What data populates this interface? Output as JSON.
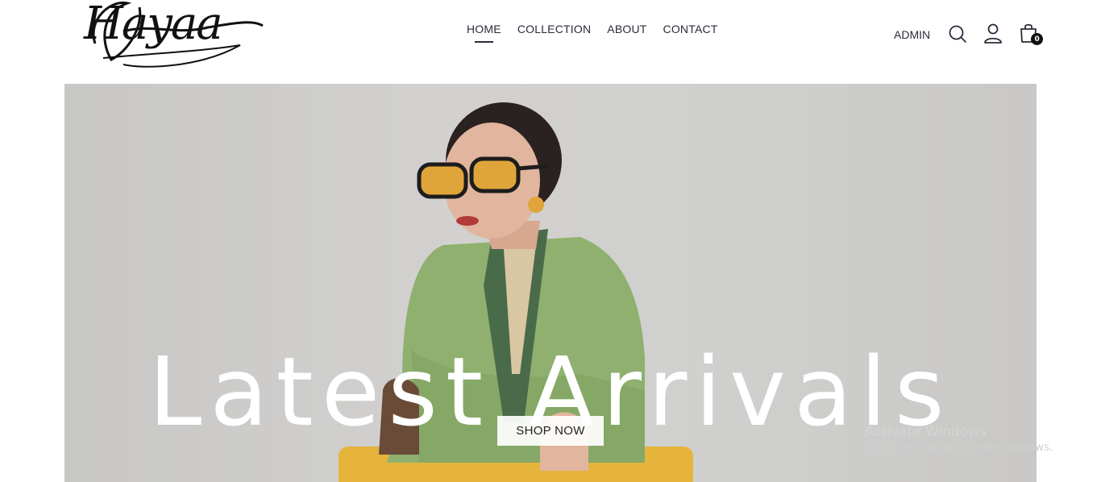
{
  "brand": {
    "logo_text": "Hayaa"
  },
  "nav": {
    "items": [
      {
        "label": "HOME",
        "active": true
      },
      {
        "label": "COLLECTION",
        "active": false
      },
      {
        "label": "ABOUT",
        "active": false
      },
      {
        "label": "CONTACT",
        "active": false
      }
    ]
  },
  "tools": {
    "admin_label": "ADMIN",
    "cart_count": "0",
    "icons": [
      "search-icon",
      "user-icon",
      "shopping-bag-icon"
    ]
  },
  "hero": {
    "title": "Latest Arrivals",
    "button_label": "SHOP NOW"
  },
  "watermark": {
    "line1": "Activate Windows",
    "line2": "Go to Settings to activate Windows."
  },
  "colors": {
    "text": "#2b2b3a",
    "jacket": "#8fb06f",
    "glasses": "#e0a53a",
    "chair": "#e6b43b"
  }
}
